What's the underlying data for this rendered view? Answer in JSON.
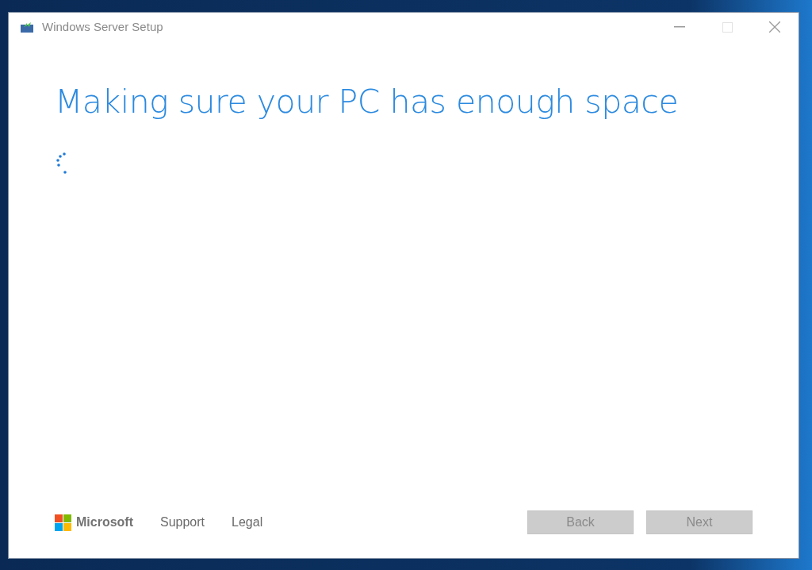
{
  "window": {
    "title": "Windows Server Setup",
    "maximize_disabled": true
  },
  "heading": "Making sure your PC has enough space",
  "footer": {
    "brand": "Microsoft",
    "links": [
      "Support",
      "Legal"
    ]
  },
  "buttons": [
    {
      "label": "Back",
      "disabled": true
    },
    {
      "label": "Next",
      "disabled": true
    }
  ]
}
